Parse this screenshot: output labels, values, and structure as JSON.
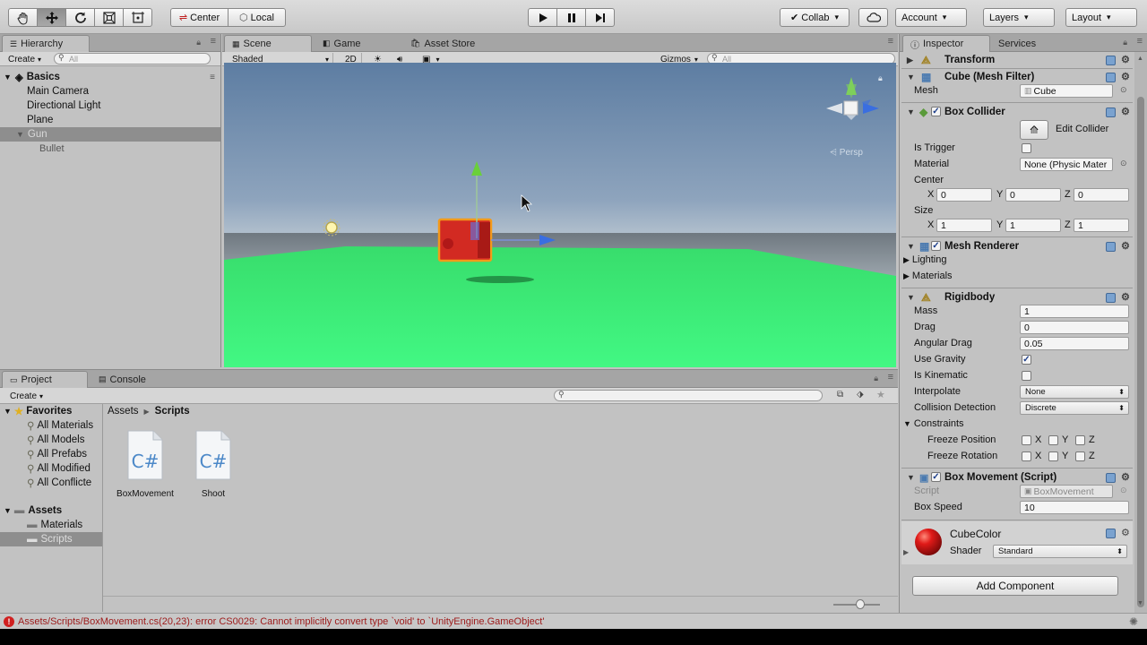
{
  "toolbar": {
    "transform_tools": [
      "hand-tool-icon",
      "move-tool-icon",
      "rotate-tool-icon",
      "scale-tool-icon",
      "rect-tool-icon"
    ],
    "pivot_label": "Center",
    "space_label": "Local",
    "collab_label": "Collab",
    "account_label": "Account",
    "layers_label": "Layers",
    "layout_label": "Layout"
  },
  "hierarchy": {
    "tab_label": "Hierarchy",
    "create_label": "Create",
    "search_placeholder": "All",
    "scene_name": "Basics",
    "items": [
      {
        "label": "Main Camera"
      },
      {
        "label": "Directional Light"
      },
      {
        "label": "Plane"
      },
      {
        "label": "Gun"
      },
      {
        "label": "Bullet"
      }
    ]
  },
  "scene": {
    "tabs": [
      "Scene",
      "Game",
      "Asset Store"
    ],
    "shading_mode": "Shaded",
    "mode_2d": "2D",
    "gizmos_label": "Gizmos",
    "search_placeholder": "All",
    "persp_label": "Persp"
  },
  "inspector": {
    "tabs": [
      "Inspector",
      "Services"
    ],
    "transform_title": "Transform",
    "mesh_filter_title": "Cube (Mesh Filter)",
    "mesh_label": "Mesh",
    "mesh_value": "Cube",
    "box_collider_title": "Box Collider",
    "edit_collider_label": "Edit Collider",
    "is_trigger_label": "Is Trigger",
    "material_label": "Material",
    "material_value": "None (Physic Mater",
    "center_label": "Center",
    "center": {
      "x": "0",
      "y": "0",
      "z": "0"
    },
    "size_label": "Size",
    "size": {
      "x": "1",
      "y": "1",
      "z": "1"
    },
    "axis_labels": {
      "x": "X",
      "y": "Y",
      "z": "Z"
    },
    "mesh_renderer_title": "Mesh Renderer",
    "lighting_label": "Lighting",
    "materials_label": "Materials",
    "rigidbody_title": "Rigidbody",
    "mass_label": "Mass",
    "mass_value": "1",
    "drag_label": "Drag",
    "drag_value": "0",
    "angular_drag_label": "Angular Drag",
    "angular_drag_value": "0.05",
    "use_gravity_label": "Use Gravity",
    "use_gravity": true,
    "is_kinematic_label": "Is Kinematic",
    "interpolate_label": "Interpolate",
    "interpolate_value": "None",
    "collision_label": "Collision Detection",
    "collision_value": "Discrete",
    "constraints_label": "Constraints",
    "freeze_position_label": "Freeze Position",
    "freeze_rotation_label": "Freeze Rotation",
    "script_title": "Box Movement (Script)",
    "script_label": "Script",
    "script_value": "BoxMovement",
    "box_speed_label": "Box Speed",
    "box_speed_value": "10",
    "material_name": "CubeColor",
    "shader_label": "Shader",
    "shader_value": "Standard",
    "add_component_label": "Add Component"
  },
  "project": {
    "tabs": [
      "Project",
      "Console"
    ],
    "create_label": "Create",
    "favorites_label": "Favorites",
    "favorites": [
      "All Materials",
      "All Models",
      "All Prefabs",
      "All Modified",
      "All Conflicte"
    ],
    "assets_label": "Assets",
    "asset_folders": [
      "Materials",
      "Scripts"
    ],
    "breadcrumb": [
      "Assets",
      "Scripts"
    ],
    "files": [
      {
        "name": "BoxMovement",
        "icon": "csharp-script-icon",
        "glyph": "C#"
      },
      {
        "name": "Shoot",
        "icon": "csharp-script-icon",
        "glyph": "C#"
      }
    ]
  },
  "status": {
    "error_text": "Assets/Scripts/BoxMovement.cs(20,23): error CS0029: Cannot implicitly convert type `void' to `UnityEngine.GameObject'"
  },
  "colors": {
    "error": "#9d1a1a",
    "selection": "#8e8e8e",
    "ground": "#3df57a",
    "cube": "#d22a22",
    "material_sphere": "#d01818"
  }
}
